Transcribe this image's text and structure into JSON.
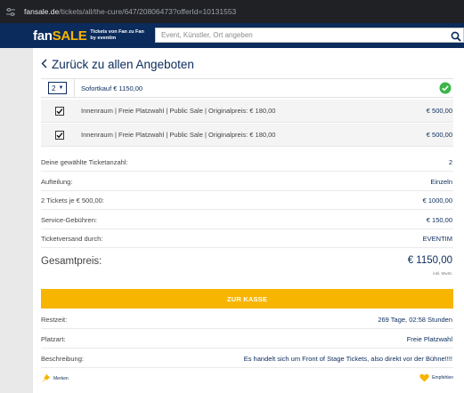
{
  "browser": {
    "url_domain": "fansale.de",
    "url_path": "/tickets/all/the-cure/647/20806473?offerId=10131553"
  },
  "header": {
    "logo_fan": "fan",
    "logo_sale": "SALE",
    "logo_sub_1": "Tickets von Fan zu Fan",
    "logo_sub_2": "by eventim",
    "search_placeholder": "Event, Künstler, Ort angeben"
  },
  "back_label": "Zurück zu allen Angeboten",
  "offer": {
    "quantity": "2",
    "label": "Sofortkauf € 1150,00"
  },
  "tickets": [
    {
      "description": "Innenraum | Freie Platzwahl | Public Sale | Originalpreis: € 180,00",
      "price": "€ 500,00",
      "checked": true
    },
    {
      "description": "Innenraum | Freie Platzwahl | Public Sale | Originalpreis: € 180,00",
      "price": "€ 500,00",
      "checked": true
    }
  ],
  "summary": [
    {
      "label": "Deine gewählte Ticketanzahl:",
      "value": "2"
    },
    {
      "label": "Aufteilung:",
      "value": "Einzeln"
    },
    {
      "label": "2 Tickets je € 500,00:",
      "value": "€ 1000,00"
    },
    {
      "label": "Service-Gebühren:",
      "value": "€ 150,00"
    },
    {
      "label": "Ticketversand durch:",
      "value": "EVENTIM"
    }
  ],
  "total": {
    "label": "Gesamtpreis:",
    "value": "€ 1150,00",
    "note": "inkl. MwSt."
  },
  "checkout_label": "ZUR KASSE",
  "info": [
    {
      "label": "Restzeit:",
      "value": "269 Tage, 02:58 Stunden"
    },
    {
      "label": "Platzart:",
      "value": "Freie Platzwahl"
    },
    {
      "label": "Beschreibung:",
      "value": "Es handelt sich um Front of Stage Tickets, also direkt vor der Bühne!!!!"
    }
  ],
  "footer": {
    "merken": "Merken",
    "empfehlen": "Empfehlen"
  },
  "colors": {
    "brand_navy": "#0b2b5c",
    "accent_yellow": "#f7b500",
    "success_green": "#3cb54a"
  }
}
